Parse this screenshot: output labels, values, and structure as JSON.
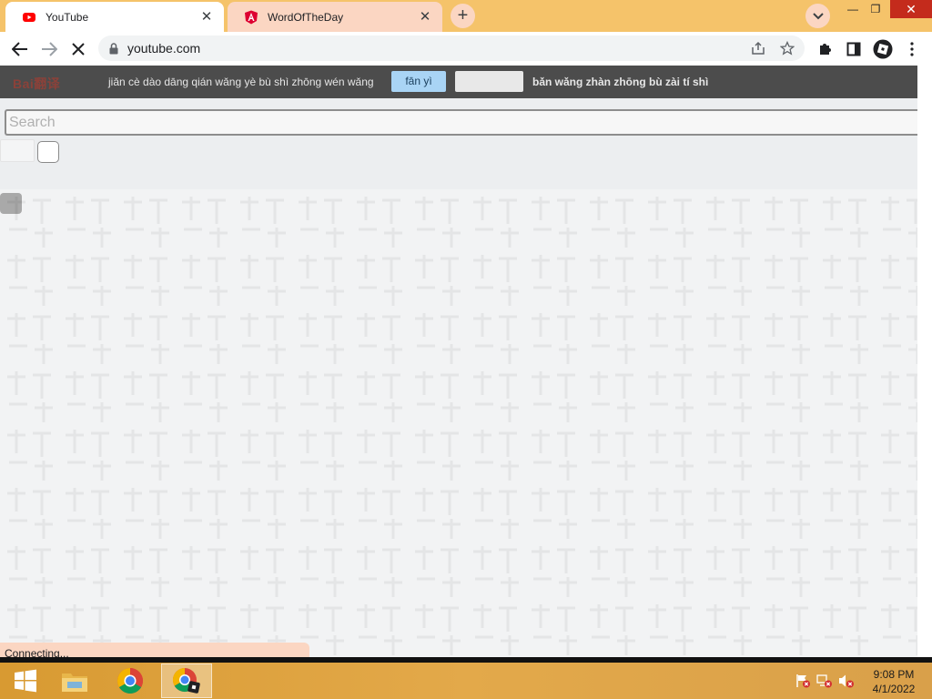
{
  "browser": {
    "tabs": [
      {
        "title": "YouTube",
        "favicon": "youtube-icon",
        "active": true
      },
      {
        "title": "WordOfTheDay",
        "favicon": "angular-icon",
        "active": false
      }
    ],
    "new_tab_label": "+",
    "tab_search_icon": "chevron-down-icon",
    "window_controls": {
      "minimize": "—",
      "restore": "❐",
      "close": "✕"
    },
    "address": "youtube.com",
    "colors": {
      "frame": "#f5c36a",
      "inactive_tab": "#fbd6c2",
      "close_red": "#c42b1c"
    }
  },
  "translate_bar": {
    "logo": "Bai翻译",
    "text_left": "jiǎn cè dào dāng qián wǎng yè bù shì zhōng wén wǎng",
    "translate_button": "fān yì",
    "text_right": "bǎn wǎng zhàn zhōng bù zài tí shì"
  },
  "page": {
    "search_placeholder": "Search",
    "status": "Connecting..."
  },
  "taskbar": {
    "apps": [
      "windows-start-icon",
      "file-explorer-icon",
      "chrome-icon",
      "chrome-roblox-icon"
    ],
    "clock_time": "9:08 PM",
    "clock_date": "4/1/2022"
  }
}
